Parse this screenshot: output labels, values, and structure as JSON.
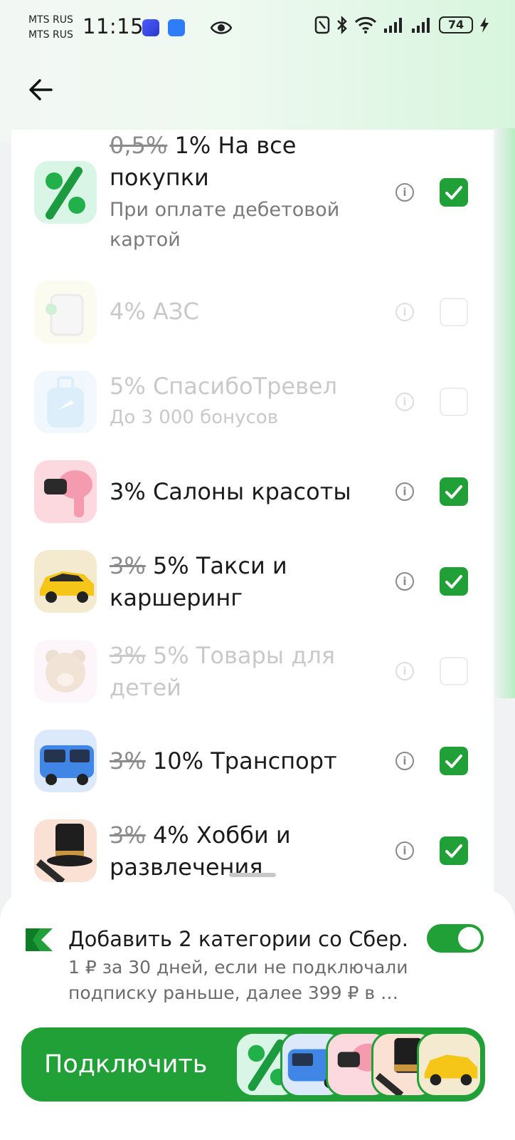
{
  "status_bar": {
    "carrier_1": "MTS RUS",
    "carrier_2": "MTS RUS",
    "time": "11:15",
    "battery": "74",
    "icons": [
      "nfc-icon",
      "bluetooth-icon",
      "wifi-icon",
      "signal-icon",
      "signal-icon",
      "battery-icon",
      "charging-icon"
    ]
  },
  "header": {
    "back_icon": "arrow-left-icon"
  },
  "categories": [
    {
      "old": "0,5%",
      "title": " 1% На все покупки",
      "subtitle": "При оплате дебетовой картой",
      "icon": "percent-icon",
      "checked": true,
      "enabled": true
    },
    {
      "old": "",
      "title": "4% АЗС",
      "subtitle": "",
      "icon": "fuel-canister-icon",
      "checked": false,
      "enabled": false
    },
    {
      "old": "",
      "title": "5% СпасибоТревел",
      "subtitle": "До 3 000 бонусов",
      "icon": "suitcase-icon",
      "checked": false,
      "enabled": false
    },
    {
      "old": "",
      "title": "3% Салоны красоты",
      "subtitle": "",
      "icon": "hair-dryer-icon",
      "checked": true,
      "enabled": true
    },
    {
      "old": "3%",
      "title": " 5% Такси и каршеринг",
      "subtitle": "",
      "icon": "taxi-car-icon",
      "checked": true,
      "enabled": true
    },
    {
      "old": "3%",
      "title": " 5% Товары для детей",
      "subtitle": "",
      "icon": "teddy-bear-icon",
      "checked": false,
      "enabled": false
    },
    {
      "old": "3%",
      "title": " 10% Транспорт",
      "subtitle": "",
      "icon": "bus-icon",
      "checked": true,
      "enabled": true
    },
    {
      "old": "3%",
      "title": " 4% Хобби и развлечения",
      "subtitle": "",
      "icon": "top-hat-icon",
      "checked": true,
      "enabled": true
    }
  ],
  "subscription": {
    "title": "Добавить 2 категории со Сбер…",
    "subtitle": "1 ₽ за 30 дней, если не подключали подписку раньше, далее 399 ₽ в …",
    "toggle_on": true,
    "logo": "sber-prime-logo"
  },
  "connect_button": {
    "label": "Подключить"
  },
  "colors": {
    "accent": "#21a038",
    "text": "#1b1b1b",
    "secondary": "#7a7a7a"
  }
}
